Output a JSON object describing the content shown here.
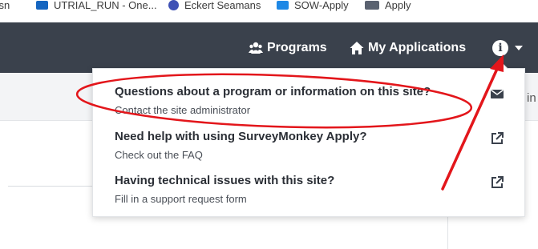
{
  "bookmarks": [
    {
      "label": "ssn",
      "color": "#2b6cb0"
    },
    {
      "label": "UTRIAL_RUN - One...",
      "color": "#1565c0"
    },
    {
      "label": "Eckert Seamans",
      "color": "#3f51b5"
    },
    {
      "label": "SOW-Apply",
      "color": "#1e88e5"
    },
    {
      "label": "Apply",
      "color": "#5a6270"
    }
  ],
  "navbar": {
    "programs_label": "Programs",
    "applications_label": "My Applications",
    "info_glyph": "i",
    "bg_color": "#3a414c"
  },
  "page": {
    "peek_text": "in"
  },
  "dropdown": {
    "items": [
      {
        "title": "Questions about a program or information on this site?",
        "subtitle": "Contact the site administrator",
        "icon": "envelope-icon"
      },
      {
        "title": "Need help with using SurveyMonkey Apply?",
        "subtitle": "Check out the FAQ",
        "icon": "external-link-icon"
      },
      {
        "title": "Having technical issues with this site?",
        "subtitle": "Fill in a support request form",
        "icon": "external-link-icon"
      }
    ]
  },
  "annotation": {
    "color": "#e3161b",
    "shapes": [
      "ellipse",
      "arrow"
    ]
  }
}
